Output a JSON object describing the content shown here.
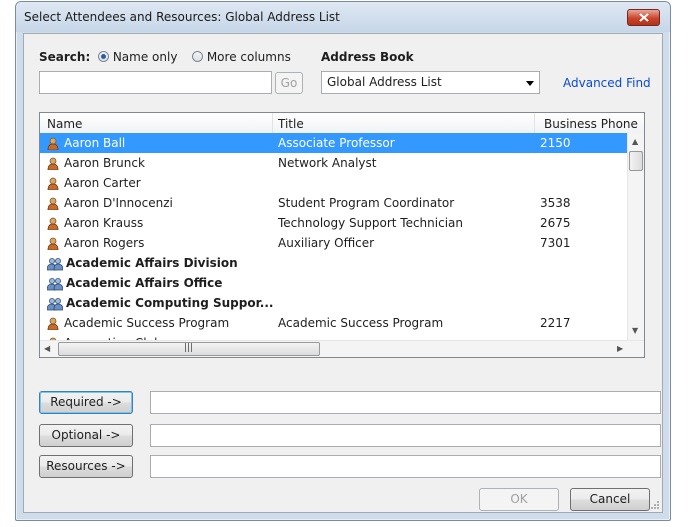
{
  "window": {
    "title": "Select Attendees and Resources: Global Address List"
  },
  "search": {
    "label": "Search:",
    "option_name_only": "Name only",
    "option_more_columns": "More columns",
    "selected_option": "Name only",
    "query_value": "",
    "go_label": "Go"
  },
  "address_book": {
    "label": "Address Book",
    "selected": "Global Address List",
    "advanced_find_label": "Advanced Find"
  },
  "list": {
    "columns": [
      "Name",
      "Title",
      "Business Phone"
    ],
    "rows": [
      {
        "name": "Aaron Ball",
        "title": "Associate Professor",
        "phone": "2150",
        "selected": true,
        "group": false
      },
      {
        "name": "Aaron Brunck",
        "title": "Network Analyst",
        "phone": "",
        "selected": false,
        "group": false
      },
      {
        "name": "Aaron Carter",
        "title": "",
        "phone": "",
        "selected": false,
        "group": false
      },
      {
        "name": "Aaron D'Innocenzi",
        "title": "Student Program Coordinator",
        "phone": "3538",
        "selected": false,
        "group": false
      },
      {
        "name": "Aaron Krauss",
        "title": "Technology Support Technician",
        "phone": "2675",
        "selected": false,
        "group": false
      },
      {
        "name": "Aaron Rogers",
        "title": "Auxiliary Officer",
        "phone": "7301",
        "selected": false,
        "group": false
      },
      {
        "name": "Academic Affairs Division",
        "title": "",
        "phone": "",
        "selected": false,
        "group": true
      },
      {
        "name": "Academic Affairs Office",
        "title": "",
        "phone": "",
        "selected": false,
        "group": true
      },
      {
        "name": "Academic Computing Suppor...",
        "title": "",
        "phone": "",
        "selected": false,
        "group": true
      },
      {
        "name": "Academic Success Program",
        "title": "Academic Success Program",
        "phone": "2217",
        "selected": false,
        "group": false
      },
      {
        "name": "Accounting Club",
        "title": "",
        "phone": "",
        "selected": false,
        "group": false
      }
    ]
  },
  "recipients": {
    "required_label": "Required ->",
    "optional_label": "Optional ->",
    "resources_label": "Resources ->",
    "required_value": "",
    "optional_value": "",
    "resources_value": ""
  },
  "footer": {
    "ok_label": "OK",
    "cancel_label": "Cancel"
  },
  "colors": {
    "selection": "#3399ff",
    "link": "#0a4ad2",
    "close_button": "#c9452d"
  }
}
